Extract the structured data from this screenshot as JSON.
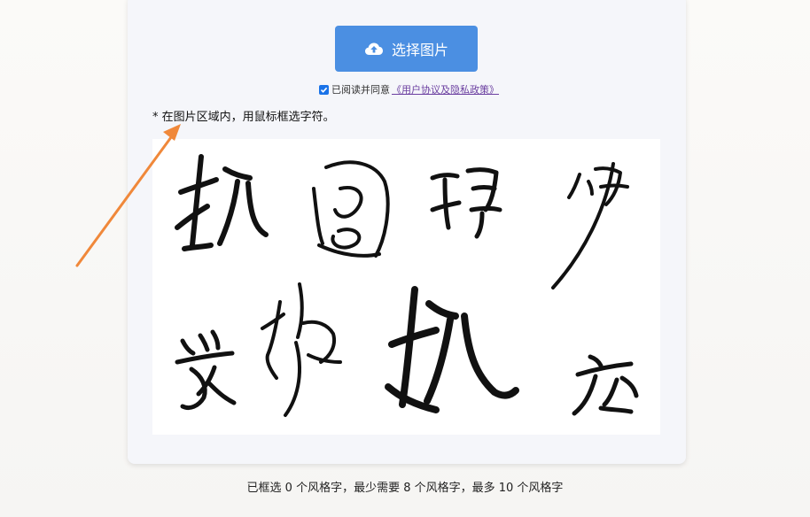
{
  "upload": {
    "button_label": "选择图片",
    "icon": "cloud-upload-icon"
  },
  "agreement": {
    "checked": true,
    "text": "已阅读并同意",
    "link_text": "《用户协议及隐私政策》"
  },
  "hint": "* 在图片区域内，用鼠标框选字符。",
  "status": {
    "text": "已框选 0 个风格字，最少需要 8 个风格字，最多 10 个风格字"
  },
  "colors": {
    "primary_button": "#4b8fe2",
    "annotation_arrow": "#f0883a",
    "checkbox": "#1a73e8",
    "link": "#6b3fa0"
  }
}
